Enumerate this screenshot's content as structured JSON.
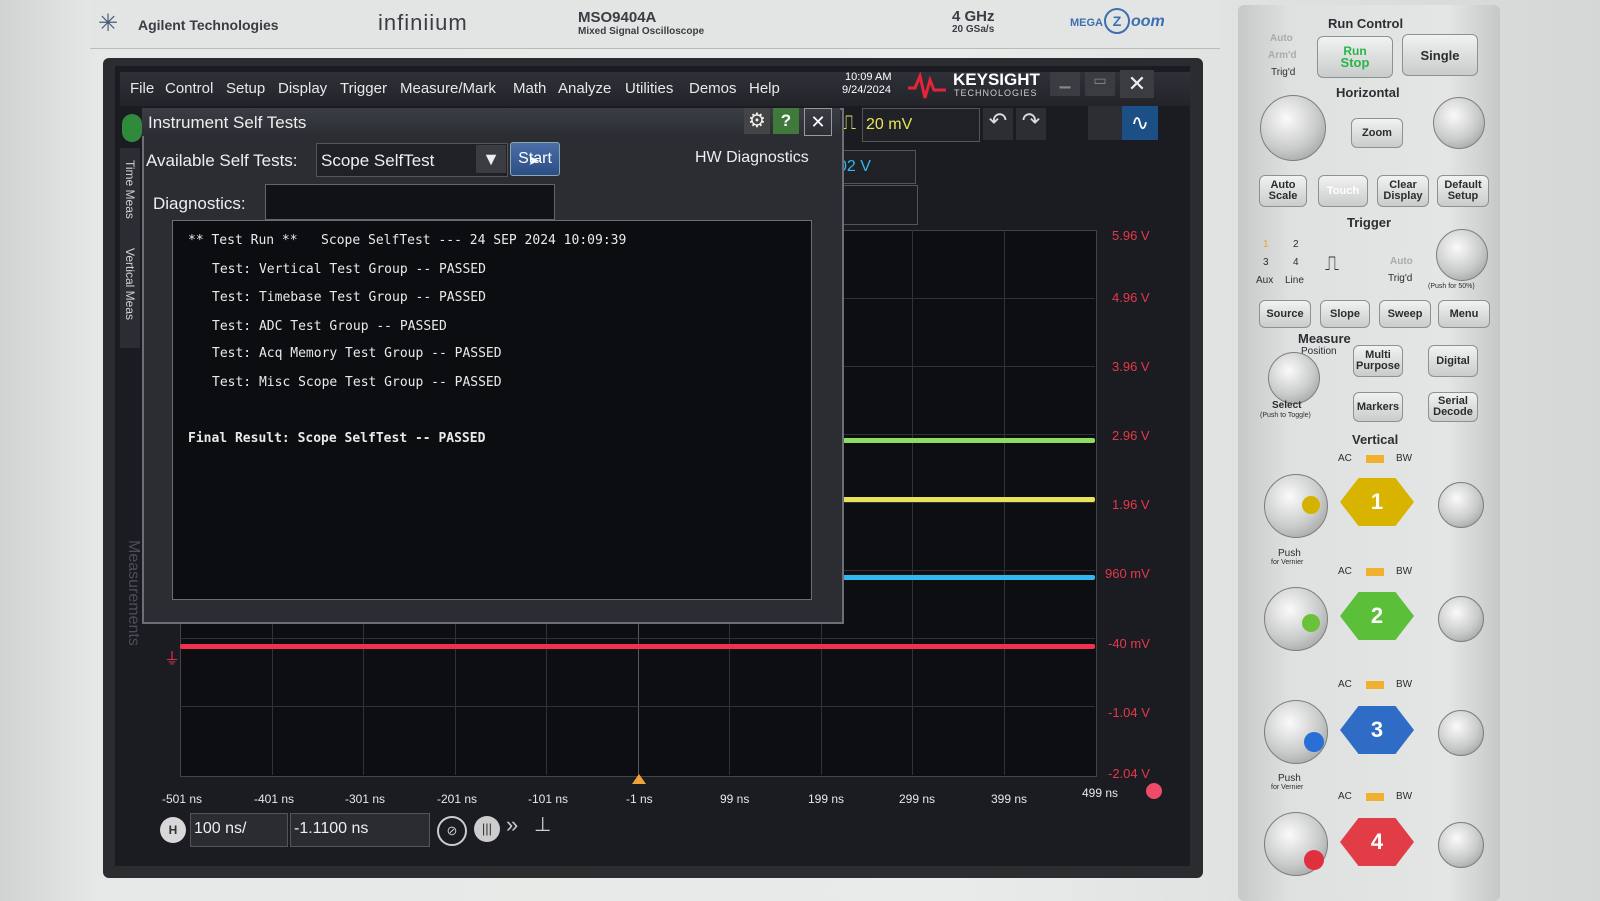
{
  "brand": {
    "company": "Agilent Technologies",
    "product": "infiniium",
    "model": "MSO9404A",
    "model_sub": "Mixed Signal Oscilloscope",
    "bandwidth": "4 GHz",
    "sample_rate": "20 GSa/s",
    "mega": "MEGA",
    "zoom": "oom"
  },
  "menu": {
    "items": [
      "File",
      "Control",
      "Setup",
      "Display",
      "Trigger",
      "Measure/Mark",
      "Math",
      "Analyze",
      "Utilities",
      "Demos",
      "Help"
    ],
    "time": "10:09 AM",
    "date": "9/24/2024",
    "logo": "KEYSIGHT",
    "logo_sub": "TECHNOLOGIES"
  },
  "toolbar": {
    "trigger_level": "20 mV",
    "hidden_value": "02 V"
  },
  "dialog": {
    "title": "Instrument Self Tests",
    "available_label": "Available Self Tests:",
    "available_value": "Scope SelfTest",
    "start_label": "Start",
    "hw_diag": "HW Diagnostics",
    "diag_label": "Diagnostics:",
    "diag_value": "",
    "log": [
      "** Test Run **   Scope SelfTest --- 24 SEP 2024 10:09:39",
      "Test: Vertical Test Group -- PASSED",
      "Test: Timebase Test Group -- PASSED",
      "Test: ADC Test Group -- PASSED",
      "Test: Acq Memory Test Group -- PASSED",
      "Test: Misc Scope Test Group -- PASSED",
      "Final Result: Scope SelfTest -- PASSED"
    ]
  },
  "side_tabs": {
    "left1": "Time Meas",
    "left2": "Vertical Meas",
    "measurements": "Measurements"
  },
  "volts": [
    "5.96 V",
    "4.96 V",
    "3.96 V",
    "2.96 V",
    "1.96 V",
    "960 mV",
    "-40 mV",
    "-1.04 V",
    "-2.04 V"
  ],
  "times": [
    "-501 ns",
    "-401 ns",
    "-301 ns",
    "-201 ns",
    "-101 ns",
    "-1 ns",
    "99 ns",
    "199 ns",
    "299 ns",
    "399 ns",
    "499 ns"
  ],
  "bottom": {
    "h_label": "H",
    "timebase": "100 ns/",
    "position": "-1.1100 ns"
  },
  "colors": {
    "ch1": "#e8e35a",
    "ch2": "#8fdc63",
    "ch3": "#33b7f0",
    "ch4": "#f2304f",
    "volt_text": "#e5394b"
  },
  "panel": {
    "run_control": "Run Control",
    "run": "Run",
    "stop": "Stop",
    "single": "Single",
    "auto": "Auto",
    "armd": "Arm'd",
    "trigd": "Trig'd",
    "horizontal": "Horizontal",
    "zoom": "Zoom",
    "auto_scale": "Auto Scale",
    "touch": "Touch",
    "clear_display": "Clear Display",
    "default_setup": "Default Setup",
    "trigger": "Trigger",
    "n1": "1",
    "n2": "2",
    "n3": "3",
    "n4": "4",
    "aux": "Aux",
    "line": "Line",
    "trig_auto": "Auto",
    "trig_trigd": "Trig'd",
    "push50": "(Push for 50%)",
    "source": "Source",
    "slope": "Slope",
    "sweep": "Sweep",
    "menu": "Menu",
    "measure": "Measure",
    "position": "Position",
    "multi_purpose": "Multi Purpose",
    "digital": "Digital",
    "select": "Select",
    "push_toggle": "(Push to Toggle)",
    "markers": "Markers",
    "serial_decode": "Serial Decode",
    "vertical": "Vertical",
    "ac": "AC",
    "bw": "BW",
    "push": "Push",
    "for_vernier": "for Vernier",
    "ch": [
      "1",
      "2",
      "3",
      "4"
    ]
  }
}
